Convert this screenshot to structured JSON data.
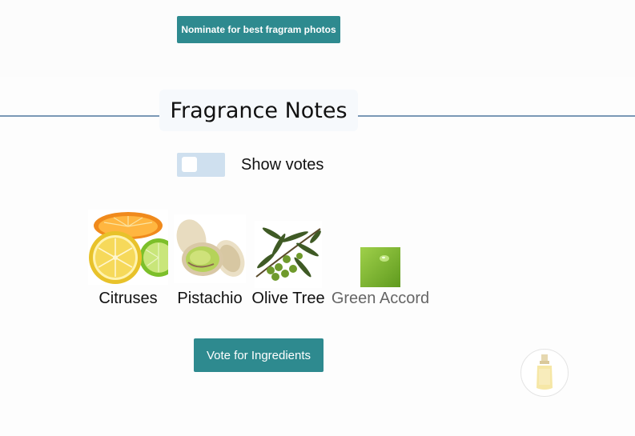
{
  "header": {
    "nominate_label": "Nominate for best fragram photos"
  },
  "notes_section": {
    "title": "Fragrance Notes",
    "show_votes_label": "Show votes",
    "show_votes_on": false,
    "notes": [
      {
        "label": "Citruses",
        "icon": "citrus-fruits-photo"
      },
      {
        "label": "Pistachio",
        "icon": "pistachio-photo"
      },
      {
        "label": "Olive Tree",
        "icon": "olive-branch-photo"
      },
      {
        "label": "Green Accord",
        "icon": "green-leaf-droplet-photo"
      }
    ],
    "vote_button_label": "Vote for Ingredients"
  },
  "colors": {
    "button_teal": "#2e8a8f",
    "divider": "#7b98b6",
    "toggle_track": "#cfe0ef"
  },
  "floating": {
    "icon": "perfume-bottle-icon"
  }
}
